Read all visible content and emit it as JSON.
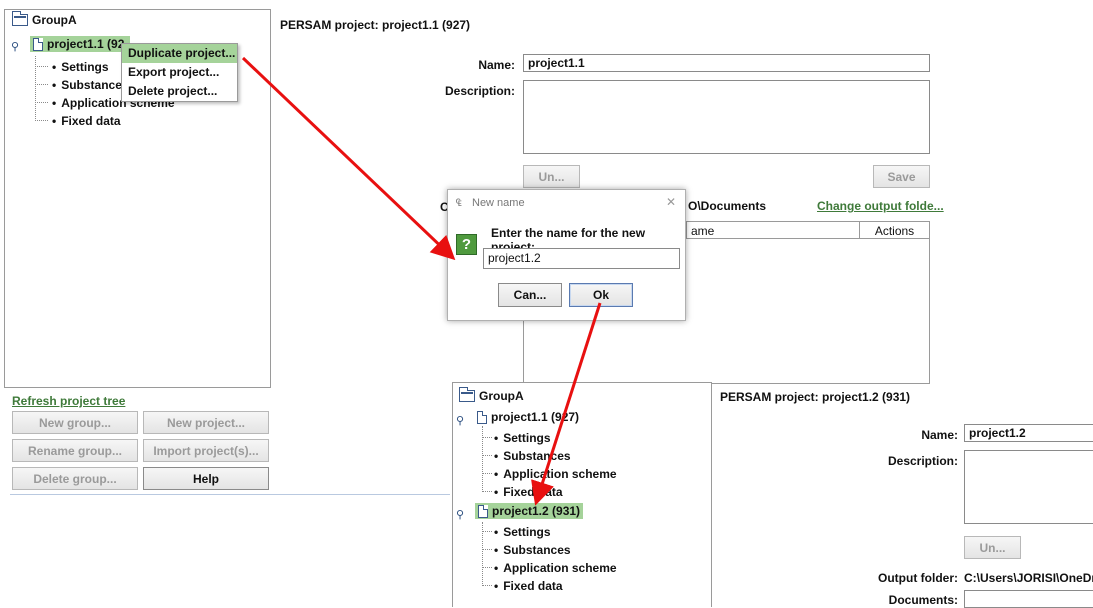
{
  "top": {
    "tree": {
      "group": "GroupA",
      "project": "project1.1 (92",
      "children": [
        "Settings",
        "Substances",
        "Application scheme",
        "Fixed data"
      ]
    },
    "context_menu": [
      "Duplicate project...",
      "Export project...",
      "Delete project..."
    ],
    "header": "PERSAM project: project1.1 (927)",
    "name_label": "Name:",
    "name_value": "project1.1",
    "description_label": "Description:",
    "undo_button": "Un...",
    "save_button": "Save",
    "output_folder_fragment": "O\\Documents",
    "change_output_link": "Change output folde...",
    "table_header_name": "ame",
    "table_header_actions": "Actions",
    "output_label_fragment": "C",
    "refresh_link": "Refresh project tree",
    "buttons": {
      "new_group": "New group...",
      "new_project": "New project...",
      "rename_group": "Rename group...",
      "import_projects": "Import project(s)...",
      "delete_group": "Delete group...",
      "help": "Help"
    }
  },
  "dialog": {
    "title": "New name",
    "close_glyph": "✕",
    "question_glyph": "?",
    "prompt": "Enter the name for the new project:",
    "value": "project1.2",
    "cancel_button": "Can...",
    "ok_button": "Ok"
  },
  "bottom": {
    "tree": {
      "group": "GroupA",
      "project_a": "project1.1 (927)",
      "children_a": [
        "Settings",
        "Substances",
        "Application scheme",
        "Fixed data"
      ],
      "project_b": "project1.2 (931)",
      "children_b": [
        "Settings",
        "Substances",
        "Application scheme",
        "Fixed data"
      ]
    },
    "header": "PERSAM project: project1.2 (931)",
    "name_label": "Name:",
    "name_value": "project1.2",
    "description_label": "Description:",
    "undo_button": "Un...",
    "output_folder_label": "Output folder:",
    "output_folder_value": "C:\\Users\\JORISI\\OneDriv",
    "documents_label": "Documents:"
  },
  "colors": {
    "selection": "#a5d39a",
    "link": "#3f7a3a",
    "arrow": "#e81010",
    "icon": "#3a5a8a"
  }
}
